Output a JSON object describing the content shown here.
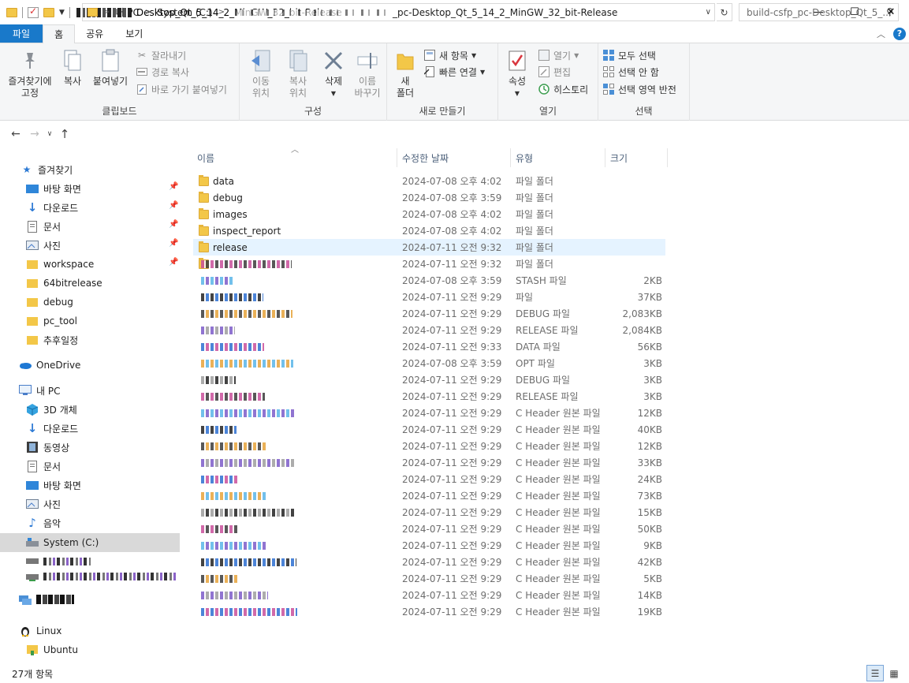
{
  "window": {
    "title": "Desktop_Qt_5_14_2_MinGW_32_bit-Release",
    "buttons": {
      "minimize": "—",
      "maximize": "☐",
      "close": "✕"
    }
  },
  "tabs": [
    "파일",
    "홈",
    "공유",
    "보기"
  ],
  "ribbon": {
    "clipboard": {
      "label": "클립보드",
      "pin": "즐겨찾기에\n고정",
      "copy": "복사",
      "paste": "붙여넣기",
      "cut": "잘라내기",
      "copy_path": "경로 복사",
      "paste_shortcut": "바로 가기 붙여넣기"
    },
    "organize": {
      "label": "구성",
      "move_to": "이동\n위치",
      "copy_to": "복사\n위치",
      "delete": "삭제",
      "rename": "이름\n바꾸기"
    },
    "new": {
      "label": "새로 만들기",
      "new_folder": "새\n폴더",
      "new_item": "새 항목",
      "easy_access": "빠른 연결"
    },
    "open": {
      "label": "열기",
      "properties": "속성",
      "open": "열기",
      "edit": "편집",
      "history": "히스토리"
    },
    "select": {
      "label": "선택",
      "select_all": "모두 선택",
      "select_none": "선택 안 함",
      "invert": "선택 영역 반전"
    }
  },
  "address": {
    "crumbs": [
      "내 PC",
      "System (C:)"
    ],
    "tail": "_pc-Desktop_Qt_5_14_2_MinGW_32_bit-Release",
    "search_placeholder": "build-csfp_pc-Desktop_Qt_5_..."
  },
  "nav": {
    "quick_access": "즐겨찾기",
    "quick_items": [
      "바탕 화면",
      "다운로드",
      "문서",
      "사진",
      "workspace",
      "64bitrelease",
      "debug",
      "pc_tool",
      "추후일정"
    ],
    "onedrive": "OneDrive",
    "this_pc": "내 PC",
    "pc_items": [
      "3D 개체",
      "다운로드",
      "동영상",
      "문서",
      "바탕 화면",
      "사진",
      "음악",
      "System (C:)"
    ],
    "linux": "Linux",
    "ubuntu": "Ubuntu"
  },
  "columns": {
    "name": "이름",
    "date": "수정한 날짜",
    "type": "유형",
    "size": "크기"
  },
  "files": [
    {
      "name": "data",
      "date": "2024-07-08 오후 4:02",
      "type": "파일 폴더",
      "size": ""
    },
    {
      "name": "debug",
      "date": "2024-07-08 오후 3:59",
      "type": "파일 폴더",
      "size": ""
    },
    {
      "name": "images",
      "date": "2024-07-08 오후 4:02",
      "type": "파일 폴더",
      "size": ""
    },
    {
      "name": "inspect_report",
      "date": "2024-07-08 오후 4:02",
      "type": "파일 폴더",
      "size": ""
    },
    {
      "name": "release",
      "date": "2024-07-11 오전 9:32",
      "type": "파일 폴더",
      "size": ""
    },
    {
      "name": "",
      "date": "2024-07-11 오전 9:32",
      "type": "파일 폴더",
      "size": ""
    },
    {
      "name": "",
      "date": "2024-07-08 오후 3:59",
      "type": "STASH 파일",
      "size": "2KB"
    },
    {
      "name": "",
      "date": "2024-07-11 오전 9:29",
      "type": "파일",
      "size": "37KB"
    },
    {
      "name": "",
      "date": "2024-07-11 오전 9:29",
      "type": "DEBUG 파일",
      "size": "2,083KB"
    },
    {
      "name": "",
      "date": "2024-07-11 오전 9:29",
      "type": "RELEASE 파일",
      "size": "2,084KB"
    },
    {
      "name": "",
      "date": "2024-07-11 오전 9:33",
      "type": "DATA 파일",
      "size": "56KB"
    },
    {
      "name": "",
      "date": "2024-07-08 오후 3:59",
      "type": "OPT 파일",
      "size": "3KB"
    },
    {
      "name": "",
      "date": "2024-07-11 오전 9:29",
      "type": "DEBUG 파일",
      "size": "3KB"
    },
    {
      "name": "",
      "date": "2024-07-11 오전 9:29",
      "type": "RELEASE 파일",
      "size": "3KB"
    },
    {
      "name": "",
      "date": "2024-07-11 오전 9:29",
      "type": "C Header 원본 파일",
      "size": "12KB"
    },
    {
      "name": "",
      "date": "2024-07-11 오전 9:29",
      "type": "C Header 원본 파일",
      "size": "40KB"
    },
    {
      "name": "",
      "date": "2024-07-11 오전 9:29",
      "type": "C Header 원본 파일",
      "size": "12KB"
    },
    {
      "name": "",
      "date": "2024-07-11 오전 9:29",
      "type": "C Header 원본 파일",
      "size": "33KB"
    },
    {
      "name": "",
      "date": "2024-07-11 오전 9:29",
      "type": "C Header 원본 파일",
      "size": "24KB"
    },
    {
      "name": "",
      "date": "2024-07-11 오전 9:29",
      "type": "C Header 원본 파일",
      "size": "73KB"
    },
    {
      "name": "",
      "date": "2024-07-11 오전 9:29",
      "type": "C Header 원본 파일",
      "size": "15KB"
    },
    {
      "name": "",
      "date": "2024-07-11 오전 9:29",
      "type": "C Header 원본 파일",
      "size": "50KB"
    },
    {
      "name": "",
      "date": "2024-07-11 오전 9:29",
      "type": "C Header 원본 파일",
      "size": "9KB"
    },
    {
      "name": "",
      "date": "2024-07-11 오전 9:29",
      "type": "C Header 원본 파일",
      "size": "42KB"
    },
    {
      "name": "",
      "date": "2024-07-11 오전 9:29",
      "type": "C Header 원본 파일",
      "size": "5KB"
    },
    {
      "name": "",
      "date": "2024-07-11 오전 9:29",
      "type": "C Header 원본 파일",
      "size": "14KB"
    },
    {
      "name": "",
      "date": "2024-07-11 오전 9:29",
      "type": "C Header 원본 파일",
      "size": "19KB"
    }
  ],
  "status": {
    "count": "27개 항목"
  },
  "colors": {
    "accent": "#1979ca",
    "selection": "#e5f3ff",
    "nav_selected": "#d9d9d9",
    "folder": "#f3c748"
  }
}
